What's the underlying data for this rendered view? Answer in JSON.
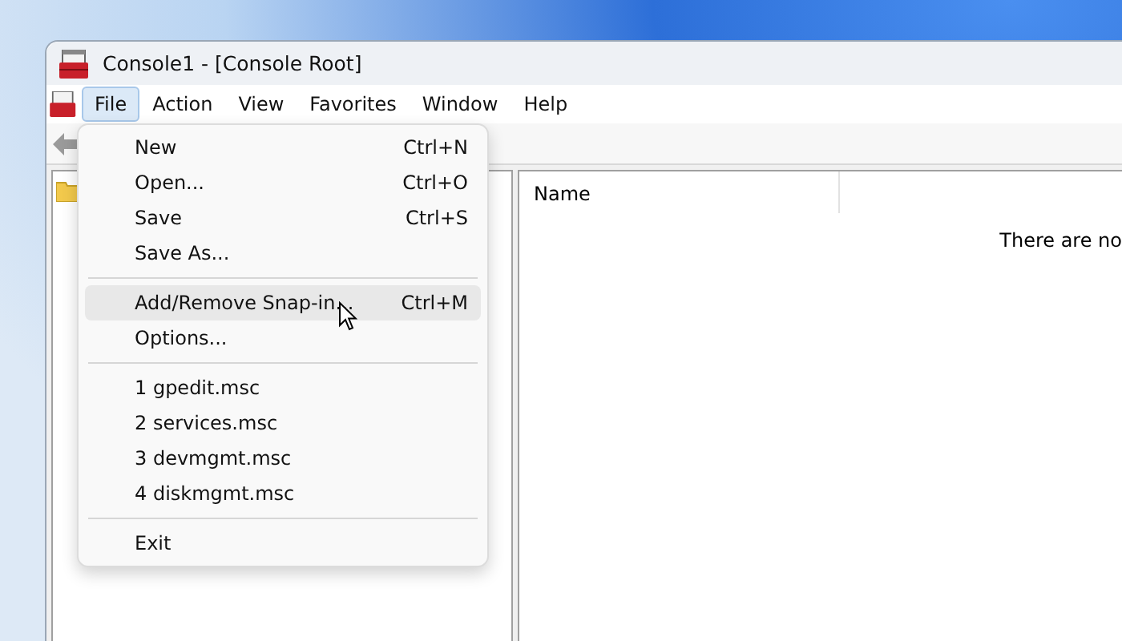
{
  "window": {
    "title": "Console1 - [Console Root]"
  },
  "menu_bar": [
    {
      "label": "File",
      "selected": true
    },
    {
      "label": "Action",
      "selected": false
    },
    {
      "label": "View",
      "selected": false
    },
    {
      "label": "Favorites",
      "selected": false
    },
    {
      "label": "Window",
      "selected": false
    },
    {
      "label": "Help",
      "selected": false
    }
  ],
  "file_menu": [
    {
      "kind": "item",
      "label": "New",
      "shortcut": "Ctrl+N",
      "selected": false
    },
    {
      "kind": "item",
      "label": "Open...",
      "shortcut": "Ctrl+O",
      "selected": false
    },
    {
      "kind": "item",
      "label": "Save",
      "shortcut": "Ctrl+S",
      "selected": false
    },
    {
      "kind": "item",
      "label": "Save As...",
      "selected": false
    },
    {
      "kind": "separator"
    },
    {
      "kind": "item",
      "label": "Add/Remove Snap-in...",
      "shortcut": "Ctrl+M",
      "selected": true
    },
    {
      "kind": "item",
      "label": "Options...",
      "selected": false
    },
    {
      "kind": "separator"
    },
    {
      "kind": "item",
      "label": "1 gpedit.msc",
      "selected": false
    },
    {
      "kind": "item",
      "label": "2 services.msc",
      "selected": false
    },
    {
      "kind": "item",
      "label": "3 devmgmt.msc",
      "selected": false
    },
    {
      "kind": "item",
      "label": "4 diskmgmt.msc",
      "selected": false
    },
    {
      "kind": "separator"
    },
    {
      "kind": "item",
      "label": "Exit",
      "selected": false
    }
  ],
  "list_view": {
    "columns": [
      "Name"
    ],
    "empty_message": "There are no"
  }
}
